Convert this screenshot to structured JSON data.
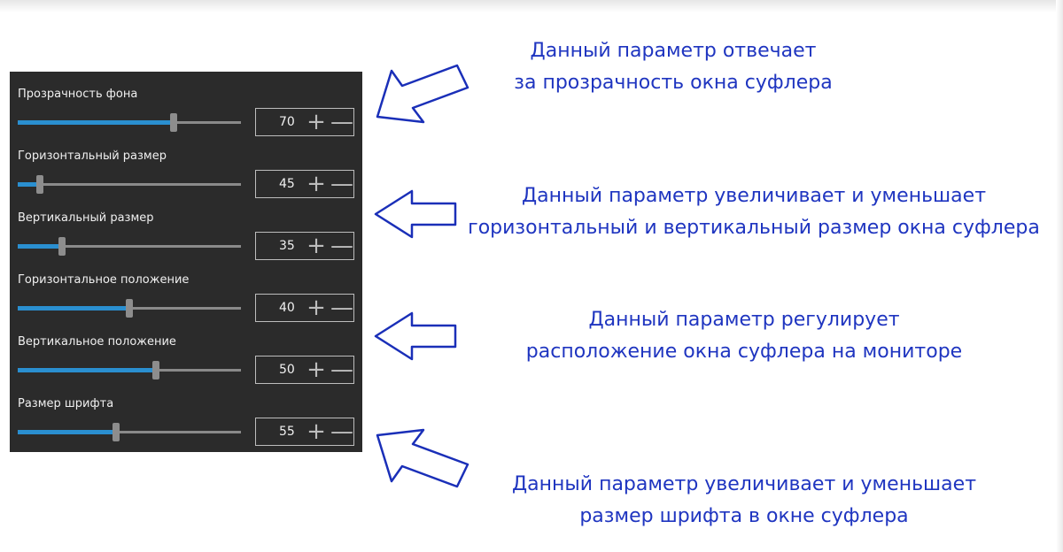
{
  "settings": [
    {
      "label": "Прозрачность фона",
      "value": "70",
      "level_percent": 70,
      "plus": "+",
      "minus": "—"
    },
    {
      "label": "Горизонтальный размер",
      "value": "45",
      "level_percent": 10,
      "plus": "+",
      "minus": "—"
    },
    {
      "label": "Вертикальный размер",
      "value": "35",
      "level_percent": 20,
      "plus": "+",
      "minus": "—"
    },
    {
      "label": "Горизонтальное положение",
      "value": "40",
      "level_percent": 50,
      "plus": "+",
      "minus": "—"
    },
    {
      "label": "Вертикальное положение",
      "value": "50",
      "level_percent": 62,
      "plus": "+",
      "minus": "—"
    },
    {
      "label": "Размер шрифта",
      "value": "55",
      "level_percent": 44,
      "plus": "+",
      "minus": "—"
    }
  ],
  "annotations": [
    {
      "line1": "Данный параметр отвечает",
      "line2": "за прозрачность окна суфлера"
    },
    {
      "line1": "Данный параметр увеличивает и уменьшает",
      "line2": "горизонтальный и вертикальный размер окна суфлера"
    },
    {
      "line1": "Данный параметр регулирует",
      "line2": "расположение окна суфлера на мониторе"
    },
    {
      "line1": "Данный параметр увеличивает и уменьшает",
      "line2": "размер шрифта в окне суфлера"
    }
  ],
  "colors": {
    "panel_bg": "#2b2b2b",
    "slider_fill": "#2a8fd0",
    "annotation_text": "#1f35c0",
    "arrow_stroke": "#1a2fb8"
  },
  "icons": {
    "arrow": "arrow-icon",
    "plus": "plus-icon",
    "minus": "minus-icon"
  }
}
